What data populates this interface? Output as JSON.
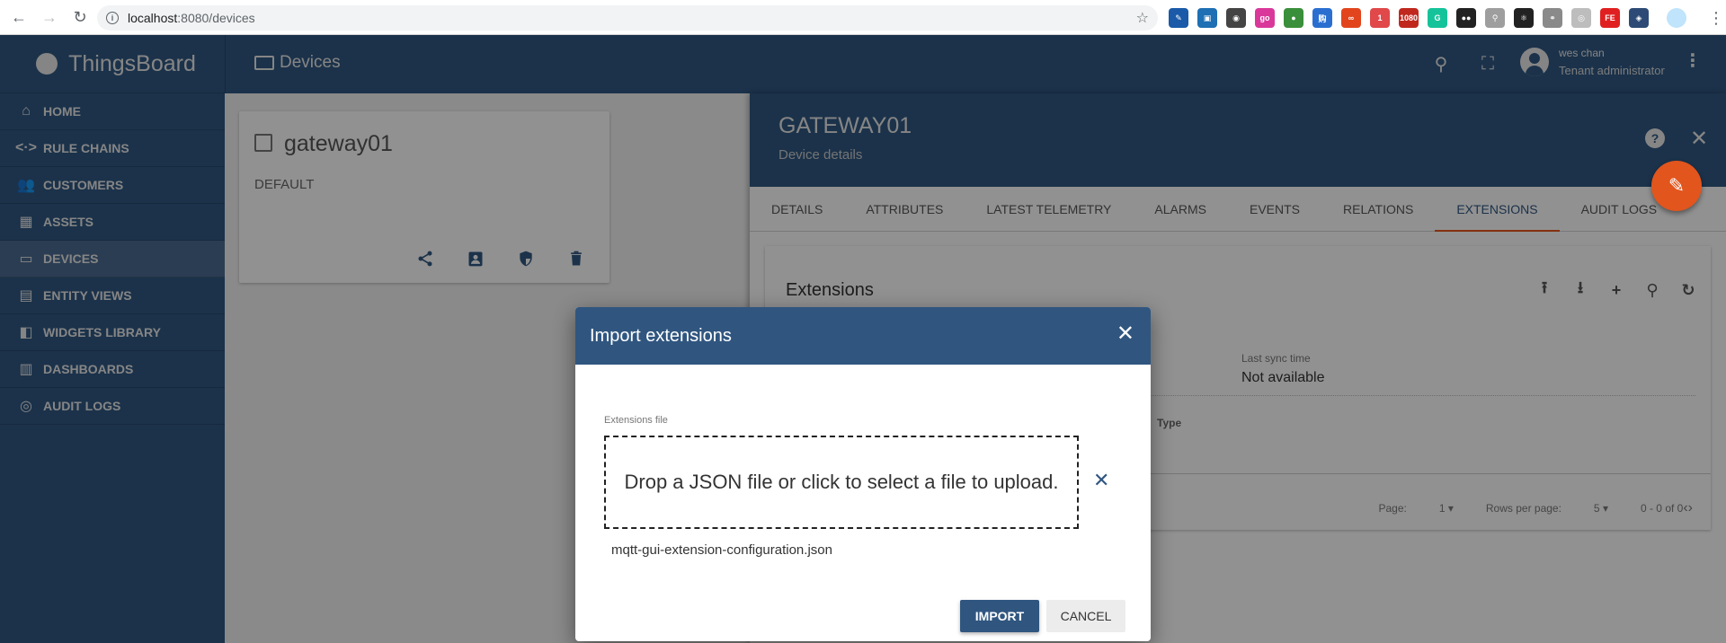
{
  "browser": {
    "url_host": "localhost",
    "url_rest": ":8080/devices",
    "nav": {
      "back": "←",
      "forward": "→",
      "reload": "↻"
    },
    "extensions": [
      {
        "name": "eyedropper-extension",
        "color": "#1a5aa8",
        "glyph": "✎"
      },
      {
        "name": "box-extension",
        "color": "#1e6fb3",
        "glyph": "▣"
      },
      {
        "name": "octotree-extension",
        "color": "#444444",
        "glyph": "◉"
      },
      {
        "name": "go-extension",
        "color": "#d9389a",
        "glyph": "go"
      },
      {
        "name": "idm-extension",
        "color": "#3a8f3a",
        "glyph": "●"
      },
      {
        "name": "gou-extension",
        "color": "#2a6fd0",
        "glyph": "购"
      },
      {
        "name": "infinity-extension",
        "color": "#e2451d",
        "glyph": "∞"
      },
      {
        "name": "badge-extension",
        "color": "#e0484a",
        "glyph": "1"
      },
      {
        "name": "1080-extension",
        "color": "#c0281e",
        "glyph": "1080"
      },
      {
        "name": "grammarly-extension",
        "color": "#15c39a",
        "glyph": "G"
      },
      {
        "name": "tampermonkey-extension",
        "color": "#222222",
        "glyph": "●●"
      },
      {
        "name": "tree-extension",
        "color": "#9e9e9e",
        "glyph": "⚲"
      },
      {
        "name": "react-devtools-extension",
        "color": "#222222",
        "glyph": "⚛"
      },
      {
        "name": "link-extension",
        "color": "#8a8a8a",
        "glyph": "⚭"
      },
      {
        "name": "target-extension",
        "color": "#bdbdbd",
        "glyph": "◎"
      },
      {
        "name": "fe-extension",
        "color": "#e02020",
        "glyph": "FE"
      },
      {
        "name": "vue-extension",
        "color": "#2c4a75",
        "glyph": "◈"
      }
    ]
  },
  "app": {
    "brand": "ThingsBoard",
    "page_title": "Devices",
    "user": {
      "name": "wes chan",
      "role": "Tenant administrator"
    }
  },
  "sidebar": {
    "items": [
      {
        "label": "HOME",
        "icon": "⌂",
        "active": false
      },
      {
        "label": "RULE CHAINS",
        "icon": "<·>",
        "active": false
      },
      {
        "label": "CUSTOMERS",
        "icon": "👥",
        "active": false
      },
      {
        "label": "ASSETS",
        "icon": "▦",
        "active": false
      },
      {
        "label": "DEVICES",
        "icon": "▭",
        "active": true
      },
      {
        "label": "ENTITY VIEWS",
        "icon": "▤",
        "active": false
      },
      {
        "label": "WIDGETS LIBRARY",
        "icon": "◧",
        "active": false
      },
      {
        "label": "DASHBOARDS",
        "icon": "▥",
        "active": false
      },
      {
        "label": "AUDIT LOGS",
        "icon": "◎",
        "active": false
      }
    ]
  },
  "device_card": {
    "name": "gateway01",
    "type": "DEFAULT"
  },
  "details": {
    "title": "GATEWAY01",
    "subtitle": "Device details",
    "tabs": [
      {
        "label": "DETAILS",
        "active": false
      },
      {
        "label": "ATTRIBUTES",
        "active": false
      },
      {
        "label": "LATEST TELEMETRY",
        "active": false
      },
      {
        "label": "ALARMS",
        "active": false
      },
      {
        "label": "EVENTS",
        "active": false
      },
      {
        "label": "RELATIONS",
        "active": false
      },
      {
        "label": "EXTENSIONS",
        "active": true
      },
      {
        "label": "AUDIT LOGS",
        "active": false
      }
    ],
    "extensions": {
      "title": "Extensions",
      "last_sync_label": "Last sync time",
      "last_sync_value": "Not available",
      "column_type": "Type",
      "pager": {
        "page_label": "Page:",
        "page_value": "1",
        "rows_label": "Rows per page:",
        "rows_value": "5",
        "range": "0 - 0 of 0"
      }
    }
  },
  "dialog": {
    "title": "Import extensions",
    "field_label": "Extensions file",
    "dropzone_text": "Drop a JSON file or click to select a file to upload.",
    "file_name": "mqtt-gui-extension-configuration.json",
    "import_label": "IMPORT",
    "cancel_label": "CANCEL"
  },
  "colors": {
    "primary": "#305680",
    "accent": "#e2551d"
  }
}
